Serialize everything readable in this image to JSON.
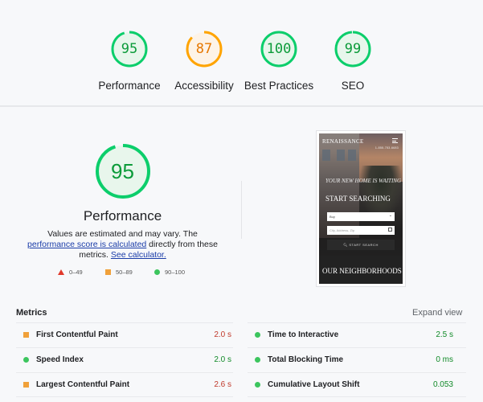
{
  "colors": {
    "pass": "#0cce6b",
    "pass_text": "#0c9b3a",
    "pass_bg": "#e8f6ec",
    "average": "#ffa400",
    "average_text": "#e67700",
    "average_bg": "#fdf3e7",
    "fail": "#e0392b",
    "metric_good_text": "#118a28",
    "metric_avg_text": "#c0392b",
    "link": "#1a3ca8"
  },
  "categories": [
    {
      "label": "Performance",
      "score": 95,
      "rating": "pass"
    },
    {
      "label": "Accessibility",
      "score": 87,
      "rating": "average"
    },
    {
      "label": "Best Practices",
      "score": 100,
      "rating": "pass"
    },
    {
      "label": "SEO",
      "score": 99,
      "rating": "pass"
    }
  ],
  "performance": {
    "score": 95,
    "title": "Performance",
    "description_prefix": "Values are estimated and may vary. The ",
    "link1": "performance score is calculated",
    "description_middle": " directly from these metrics. ",
    "link2": "See calculator."
  },
  "legend": [
    {
      "shape": "triangle",
      "range": "0–49"
    },
    {
      "shape": "square",
      "range": "50–89"
    },
    {
      "shape": "circle",
      "range": "90–100"
    }
  ],
  "screenshot": {
    "brand": "RENAISSANCE",
    "phone": "1-855-753-6683",
    "tagline": "Your new home is waiting",
    "headline": "START SEARCHING",
    "select_value": "Buy",
    "search_placeholder": "City, Address, Zip",
    "button": "START SEARCH",
    "section_heading": "OUR NEIGHBORHOODS"
  },
  "metrics": {
    "title": "Metrics",
    "expand_label": "Expand view",
    "left": [
      {
        "name": "First Contentful Paint",
        "value": "2.0 s",
        "rating": "average"
      },
      {
        "name": "Speed Index",
        "value": "2.0 s",
        "rating": "pass"
      },
      {
        "name": "Largest Contentful Paint",
        "value": "2.6 s",
        "rating": "average"
      }
    ],
    "right": [
      {
        "name": "Time to Interactive",
        "value": "2.5 s",
        "rating": "pass"
      },
      {
        "name": "Total Blocking Time",
        "value": "0 ms",
        "rating": "pass"
      },
      {
        "name": "Cumulative Layout Shift",
        "value": "0.053",
        "rating": "pass"
      }
    ]
  }
}
